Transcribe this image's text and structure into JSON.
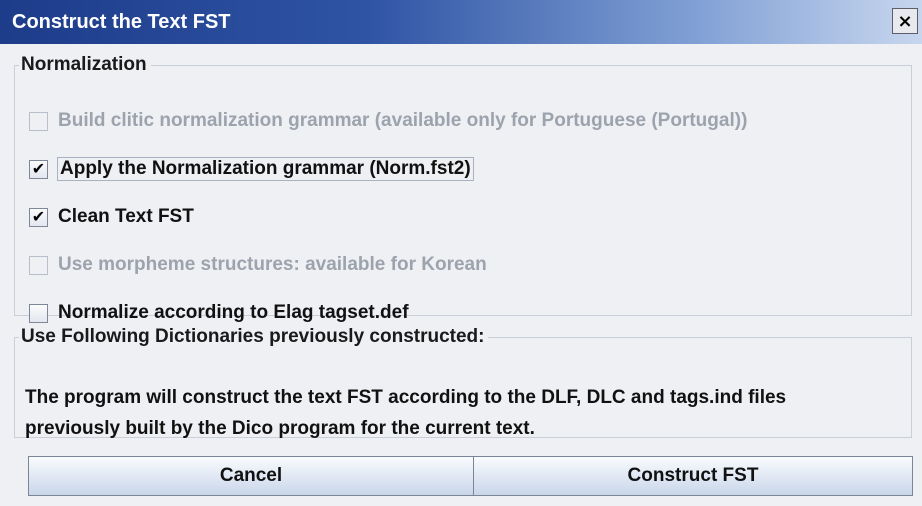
{
  "window": {
    "title": "Construct the Text FST",
    "close_glyph": "×"
  },
  "normalization": {
    "legend": "Normalization",
    "options": [
      {
        "label": "Build clitic normalization grammar (available only for Portuguese (Portugal))",
        "checked": false,
        "enabled": false
      },
      {
        "label": "Apply the Normalization grammar (Norm.fst2)",
        "checked": true,
        "enabled": true,
        "focused": true
      },
      {
        "label": "Clean Text FST",
        "checked": true,
        "enabled": true
      },
      {
        "label": "Use morpheme structures: available for Korean",
        "checked": false,
        "enabled": false
      },
      {
        "label": "Normalize according to Elag tagset.def",
        "checked": false,
        "enabled": true
      }
    ]
  },
  "dictionaries": {
    "legend": "Use Following Dictionaries previously constructed:",
    "description_line1": "The program will construct the text FST according to the DLF, DLC and tags.ind files",
    "description_line2": "previously built by the Dico program for the current text."
  },
  "buttons": {
    "cancel_label": "Cancel",
    "construct_label": "Construct FST"
  },
  "check_glyph": "✔",
  "colors": {
    "titlebar_start": "#1d3c8a",
    "titlebar_end": "#c7d6ee",
    "disabled_text": "#9da3ad",
    "background": "#eef0f4"
  }
}
